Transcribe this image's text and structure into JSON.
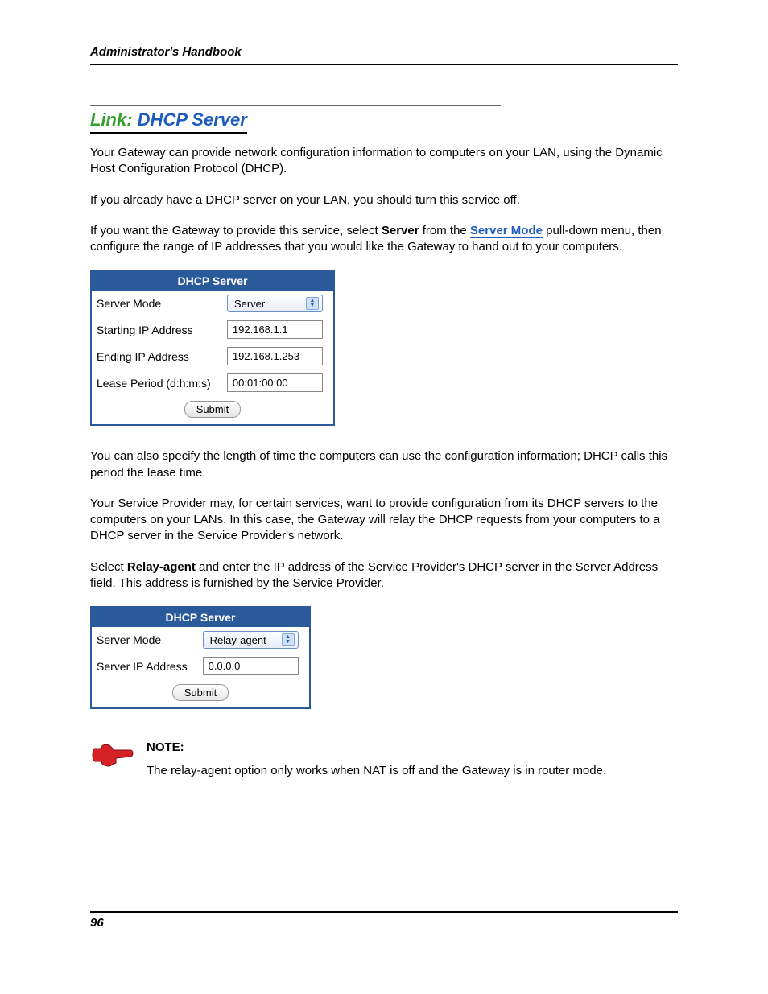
{
  "running_head": "Administrator's Handbook",
  "title_prefix": "Link: ",
  "title_main": "DHCP Server",
  "intro_p1": "Your Gateway can provide network configuration information to computers on your LAN, using the Dynamic Host Configuration Protocol (DHCP).",
  "intro_p2": "If you already have a DHCP server on your LAN, you should turn this service off.",
  "intro_p3_a": "If you want the Gateway to provide this service, select ",
  "intro_p3_bold": "Server",
  "intro_p3_b": " from the ",
  "intro_p3_link": "Server Mode",
  "intro_p3_c": " pull-down menu, then configure the range of IP addresses that you would like the Gateway to hand out to your computers.",
  "panel1": {
    "heading": "DHCP Server",
    "rows": {
      "server_mode_label": "Server Mode",
      "server_mode_value": "Server",
      "start_ip_label": "Starting IP Address",
      "start_ip_value": "192.168.1.1",
      "end_ip_label": "Ending IP Address",
      "end_ip_value": "192.168.1.253",
      "lease_label": "Lease Period (d:h:m:s)",
      "lease_value": "00:01:00:00"
    },
    "submit": "Submit"
  },
  "mid_p1": "You can also specify the length of time the computers can use the configuration information; DHCP calls this period the lease time.",
  "mid_p2": "Your Service Provider may, for certain services, want to provide configuration from its DHCP servers to the computers on your LANs. In this case, the Gateway will relay the DHCP requests from your computers to a DHCP server in the Service Provider's network.",
  "mid_p3_a": "Select ",
  "mid_p3_bold": "Relay-agent",
  "mid_p3_b": " and enter the IP address of the Service Provider's DHCP server in the Server Address field. This address is furnished by the Service Provider.",
  "panel2": {
    "heading": "DHCP Server",
    "rows": {
      "server_mode_label": "Server Mode",
      "server_mode_value": "Relay-agent",
      "server_ip_label": "Server IP Address",
      "server_ip_value": "0.0.0.0"
    },
    "submit": "Submit"
  },
  "note": {
    "label": "NOTE:",
    "text": "The relay-agent option only works when NAT is off and the Gateway is in router mode."
  },
  "page_number": "96"
}
